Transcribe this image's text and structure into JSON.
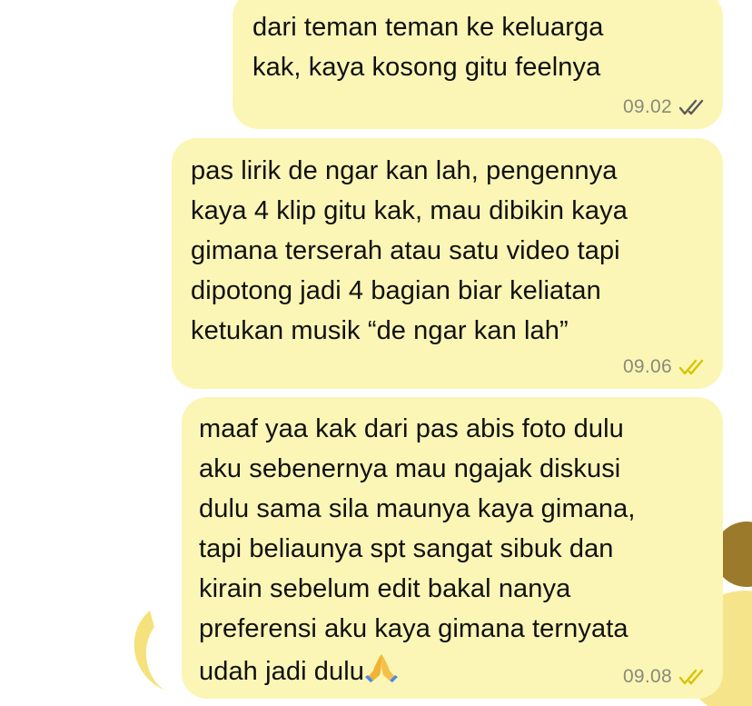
{
  "messages": [
    {
      "text": "dari teman teman ke keluarga\nkak, kaya kosong gitu feelnya",
      "time": "09.02",
      "status": "read",
      "tick_color": "#5a5a5a"
    },
    {
      "text": "pas lirik de ngar kan lah, pengennya\nkaya 4 klip gitu kak, mau dibikin kaya\ngimana terserah atau satu video tapi\ndipotong jadi 4 bagian biar keliatan\nketukan musik “de ngar kan lah”",
      "time": "09.06",
      "status": "read",
      "tick_color": "#d9c200"
    },
    {
      "text": "maaf yaa kak dari pas abis foto dulu\naku sebenernya mau ngajak diskusi\ndulu sama sila maunya kaya gimana,\ntapi beliaunya spt sangat sibuk dan\nkirain sebelum edit bakal nanya\npreferensi aku kaya gimana ternyata\nudah jadi dulu",
      "emoji": "folded-hands",
      "time": "09.08",
      "status": "read",
      "tick_color": "#d9c200"
    }
  ],
  "theme": {
    "bubble_color": "#fbf6b6",
    "wallpaper_accent": "#f3e27a"
  }
}
